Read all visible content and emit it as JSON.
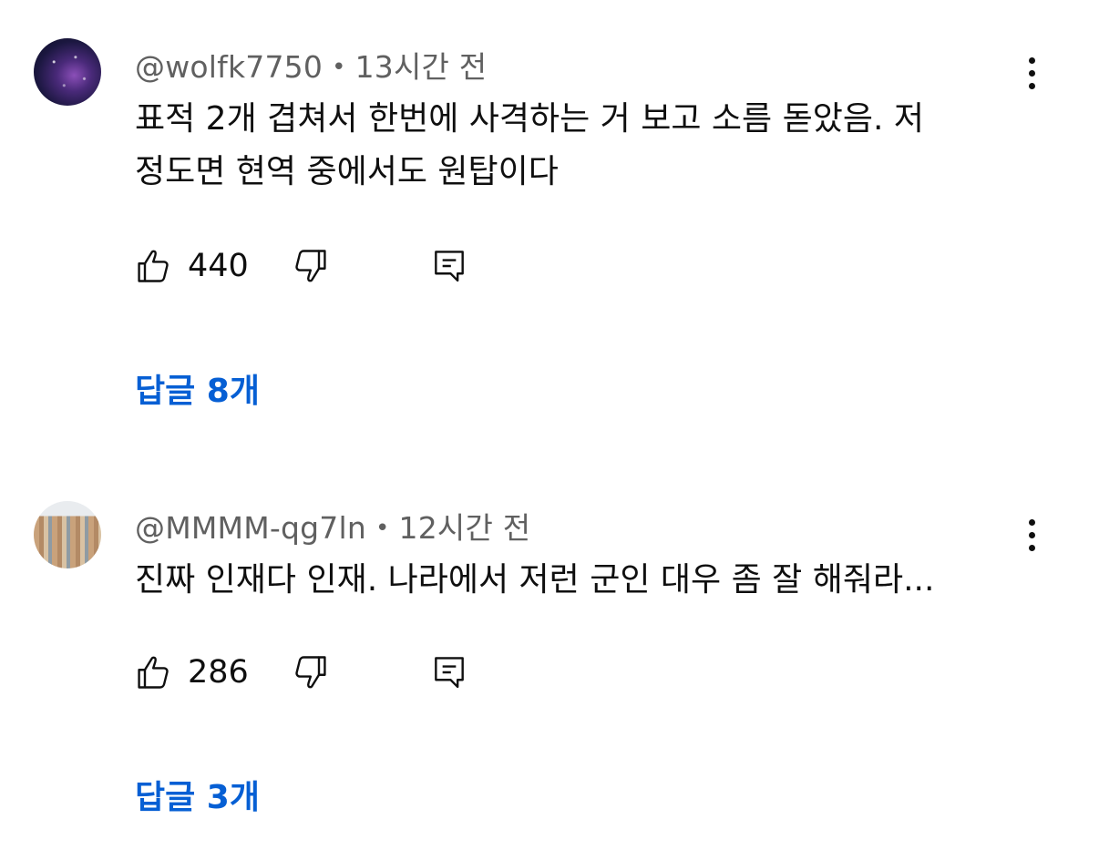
{
  "comments": [
    {
      "author": "@wolfk7750",
      "separator": "•",
      "time": "13시간 전",
      "text_line1": "표적 2개 겹쳐서 한번에 사격하는 거 보고 소름 돋았음. 저",
      "text_line2": "정도면 현역 중에서도 원탑이다",
      "likes": "440",
      "replies_label": "답글 8개",
      "avatar_icon": "galaxy-avatar"
    },
    {
      "author": "@MMMM-qg7ln",
      "separator": "•",
      "time": "12시간 전",
      "text_line1": "진짜 인재다 인재. 나라에서 저런 군인 대우 좀 잘 해줘라...",
      "likes": "286",
      "replies_label": "답글 3개",
      "avatar_icon": "city-avatar"
    }
  ],
  "icons": {
    "like": "thumbs-up-icon",
    "dislike": "thumbs-down-icon",
    "reply": "reply-comment-icon",
    "more": "more-vertical-icon"
  },
  "colors": {
    "text": "#0f0f0f",
    "meta": "#606060",
    "link": "#065fd4"
  }
}
